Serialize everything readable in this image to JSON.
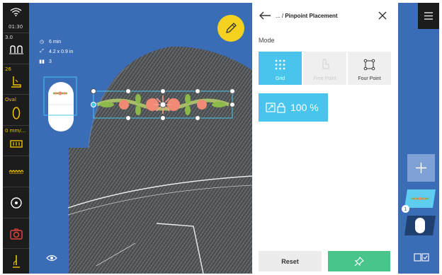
{
  "status": {
    "time": "01:30",
    "icons": [
      "wifi-icon"
    ]
  },
  "machine_bar": {
    "stitch_length": "3.0",
    "stitch_length_icon": "stitch-length-icon",
    "presser_value": "26",
    "presser_icon": "presser-foot-icon",
    "hoop_label": "Oval",
    "hoop_icon": "oval-hoop-icon",
    "speed_label": "0 mm/...",
    "speed_icon": "feed-icon",
    "tools": [
      "zigzag-stitch-icon",
      "bobbin-icon",
      "camera-icon",
      "needle-thread-icon"
    ]
  },
  "canvas": {
    "time": "6 min",
    "size": "4.2 x 0.9 in",
    "colors": "3",
    "edit_icon": "pencil-icon",
    "preview_icon": "eye-icon"
  },
  "panel": {
    "breadcrumb": "... / ",
    "title": "Pinpoint Placement",
    "mode_label": "Mode",
    "modes": [
      {
        "label": "Grid",
        "state": "active",
        "icon": "grid-points-icon"
      },
      {
        "label": "Free Point",
        "state": "disabled",
        "icon": "free-point-icon"
      },
      {
        "label": "Four Point",
        "state": "normal",
        "icon": "four-point-icon"
      }
    ],
    "scale_value": "100 %",
    "scale_icon": "scale-lock-icon",
    "reset_label": "Reset",
    "pin_icon": "pin-icon"
  },
  "right_bar": {
    "menu_icon": "hamburger-menu-icon",
    "add_icon": "plus-icon",
    "badge": "1",
    "view_icon": "split-view-icon"
  },
  "colors": {
    "canvas_blue": "#3b6db7",
    "accent_cyan": "#49c4ec",
    "confirm_green": "#47c58b",
    "fab_yellow": "#f5d21f",
    "machine_bar": "#1c1c1c"
  }
}
